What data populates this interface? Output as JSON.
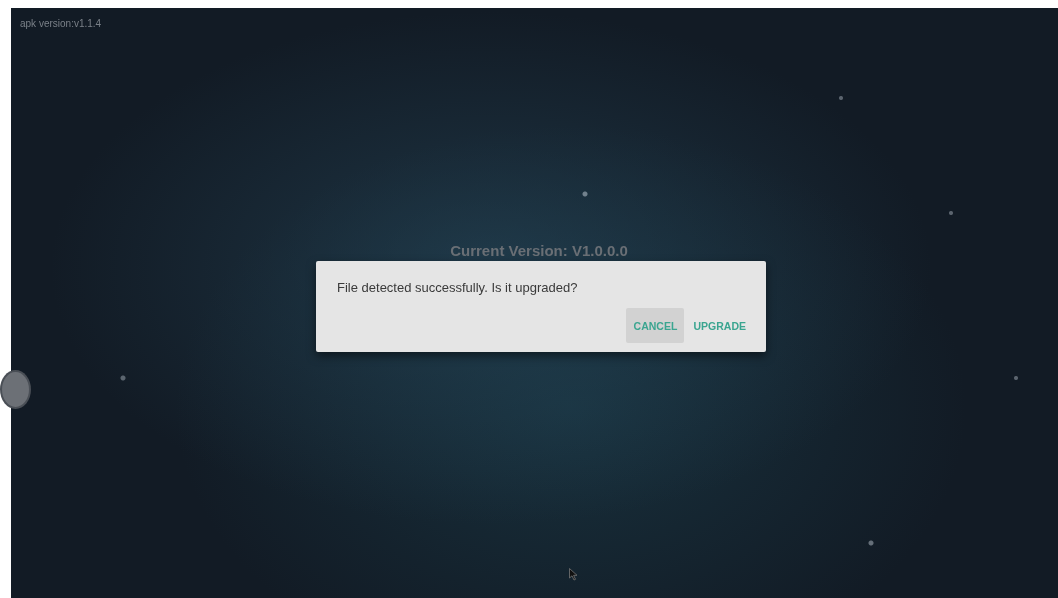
{
  "app_version": "apk version:v1.1.4",
  "current_version": "Current Version: V1.0.0.0",
  "dialog": {
    "message": "File detected successfully. Is it upgraded?",
    "buttons": [
      {
        "label": "CANCEL",
        "selected": true
      },
      {
        "label": "UPGRADE",
        "selected": false
      }
    ]
  }
}
